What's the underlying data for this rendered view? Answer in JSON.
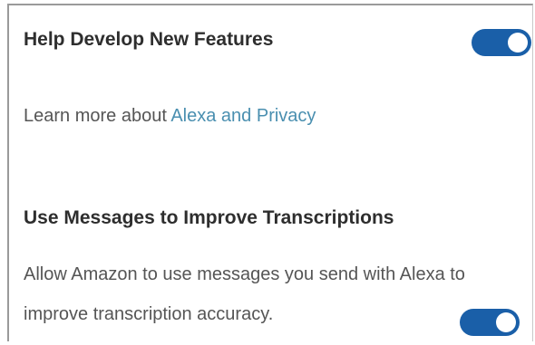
{
  "settings": {
    "help_develop": {
      "title": "Help Develop New Features",
      "enabled": true,
      "learn_more_prefix": "Learn more about ",
      "learn_more_link": "Alexa and Privacy"
    },
    "use_messages": {
      "title": "Use Messages to Improve Transcriptions",
      "description_line1": "Allow Amazon to use messages you send with Alexa to",
      "description_line2": "improve transcription accuracy.",
      "enabled": true
    }
  },
  "colors": {
    "toggle_on": "#1a5fa8",
    "link": "#4a8fb0"
  }
}
